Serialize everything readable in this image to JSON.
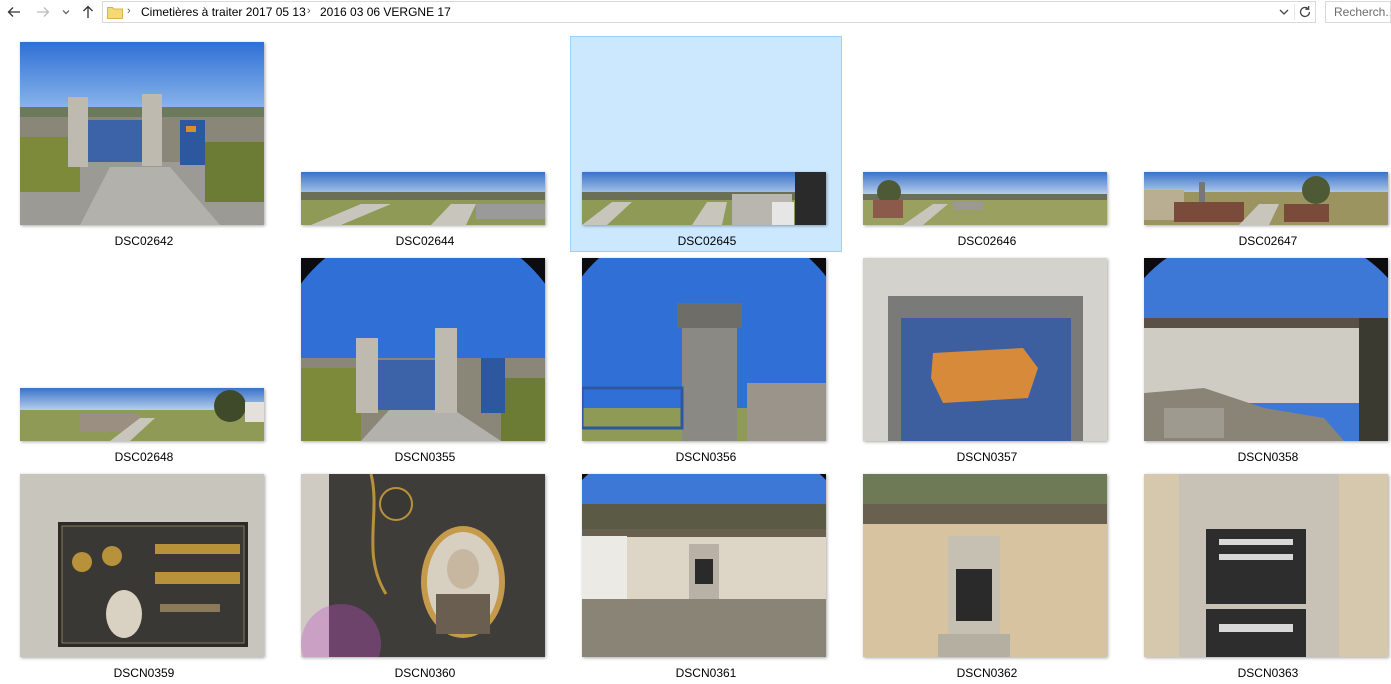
{
  "address_bar": {
    "breadcrumb": [
      "Cimetières à traiter 2017 05 13",
      "2016 03 06 VERGNE 17"
    ],
    "search_placeholder": "Recherch..."
  },
  "colors": {
    "selection_bg": "#cce8ff",
    "selection_border": "#99d1ff",
    "folder": "#f8d775"
  },
  "files": [
    {
      "name": "DSC02642",
      "selected": false,
      "orientation": "landscape"
    },
    {
      "name": "DSC02644",
      "selected": false,
      "orientation": "panorama"
    },
    {
      "name": "DSC02645",
      "selected": true,
      "orientation": "panorama"
    },
    {
      "name": "DSC02646",
      "selected": false,
      "orientation": "panorama"
    },
    {
      "name": "DSC02647",
      "selected": false,
      "orientation": "panorama"
    },
    {
      "name": "DSC02648",
      "selected": false,
      "orientation": "panorama"
    },
    {
      "name": "DSCN0355",
      "selected": false,
      "orientation": "landscape"
    },
    {
      "name": "DSCN0356",
      "selected": false,
      "orientation": "landscape"
    },
    {
      "name": "DSCN0357",
      "selected": false,
      "orientation": "landscape"
    },
    {
      "name": "DSCN0358",
      "selected": false,
      "orientation": "landscape"
    },
    {
      "name": "DSCN0359",
      "selected": false,
      "orientation": "landscape"
    },
    {
      "name": "DSCN0360",
      "selected": false,
      "orientation": "landscape"
    },
    {
      "name": "DSCN0361",
      "selected": false,
      "orientation": "landscape"
    },
    {
      "name": "DSCN0362",
      "selected": false,
      "orientation": "landscape"
    },
    {
      "name": "DSCN0363",
      "selected": false,
      "orientation": "landscape"
    }
  ],
  "icons": [
    "back-arrow-icon",
    "forward-arrow-icon",
    "recent-dropdown-icon",
    "up-arrow-icon",
    "folder-icon",
    "chevron-right-icon",
    "chevron-down-icon",
    "refresh-icon"
  ]
}
